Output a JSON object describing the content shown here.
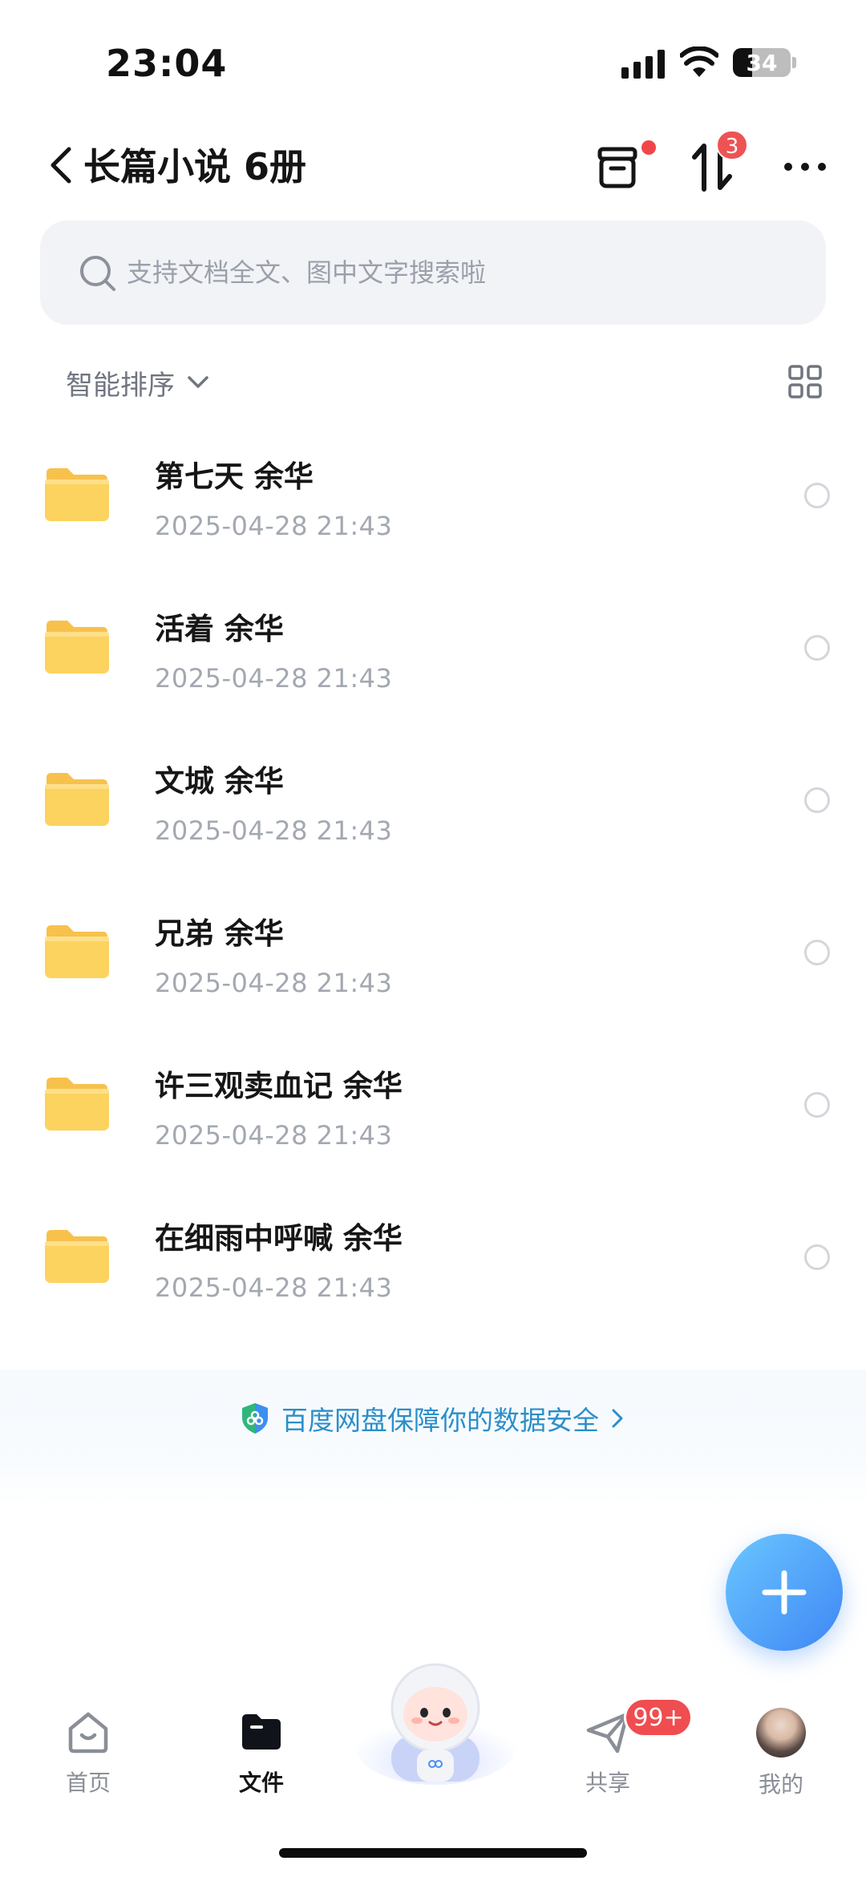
{
  "status_bar": {
    "time": "23:04",
    "battery_level": "34",
    "battery_fraction": 0.34
  },
  "header": {
    "title": "长篇小说 6册",
    "back_icon": "chevron-left-icon",
    "actions": [
      "recycle-bin-icon",
      "transfer-icon",
      "more-icon"
    ],
    "transfer_badge": "3"
  },
  "search": {
    "placeholder": "支持文档全文、图中文字搜索啦",
    "value": ""
  },
  "sort": {
    "label": "智能排序",
    "view_toggle_icon": "grid-view-icon"
  },
  "files": [
    {
      "name": "第七天 余华",
      "date": "2025-04-28 21:43"
    },
    {
      "name": "活着 余华",
      "date": "2025-04-28 21:43"
    },
    {
      "name": "文城 余华",
      "date": "2025-04-28 21:43"
    },
    {
      "name": "兄弟 余华",
      "date": "2025-04-28 21:43"
    },
    {
      "name": "许三观卖血记 余华",
      "date": "2025-04-28 21:43"
    },
    {
      "name": "在细雨中呼喊 余华",
      "date": "2025-04-28 21:43"
    }
  ],
  "security_banner": {
    "text": "百度网盘保障你的数据安全"
  },
  "fab": {
    "icon": "plus-icon"
  },
  "tabs": {
    "home": "首页",
    "files": "文件",
    "share": "共享",
    "mine": "我的",
    "share_badge": "99+"
  },
  "colors": {
    "accent": "#3e86f5",
    "badge_red": "#ef4d4f",
    "folder_yellow": "#fcd35e",
    "security_text": "#2c8ec9"
  }
}
